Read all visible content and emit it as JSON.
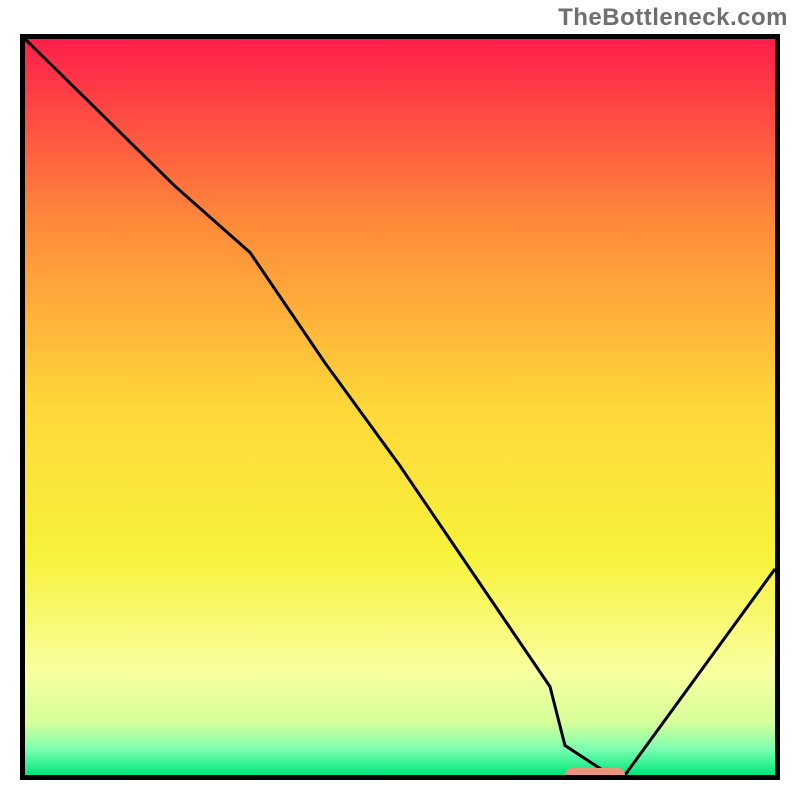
{
  "watermark": "TheBottleneck.com",
  "chart_data": {
    "type": "line",
    "title": "",
    "xlabel": "",
    "ylabel": "",
    "xlim": [
      0,
      100
    ],
    "ylim": [
      0,
      100
    ],
    "x": [
      0,
      10,
      20,
      30,
      40,
      50,
      60,
      70,
      72,
      78,
      80,
      90,
      100
    ],
    "values": [
      100,
      90,
      80,
      71,
      56,
      42,
      27,
      12,
      4,
      0,
      0,
      14,
      28
    ],
    "annotations": [
      {
        "type": "marker",
        "x_start": 72,
        "x_end": 80,
        "y": 0,
        "color": "#e9967c"
      }
    ],
    "background_gradient": {
      "stops": [
        {
          "offset": 0.0,
          "color": "#ff1e4a"
        },
        {
          "offset": 0.25,
          "color": "#ff8a3a"
        },
        {
          "offset": 0.5,
          "color": "#ffd83a"
        },
        {
          "offset": 0.7,
          "color": "#f7f23a"
        },
        {
          "offset": 0.86,
          "color": "#f9ffa0"
        },
        {
          "offset": 0.93,
          "color": "#d4ff9a"
        },
        {
          "offset": 0.965,
          "color": "#7bffb0"
        },
        {
          "offset": 1.0,
          "color": "#00e57e"
        }
      ]
    },
    "colors": {
      "curve": "#000000",
      "frame": "#000000",
      "marker": "#e9967c"
    }
  }
}
